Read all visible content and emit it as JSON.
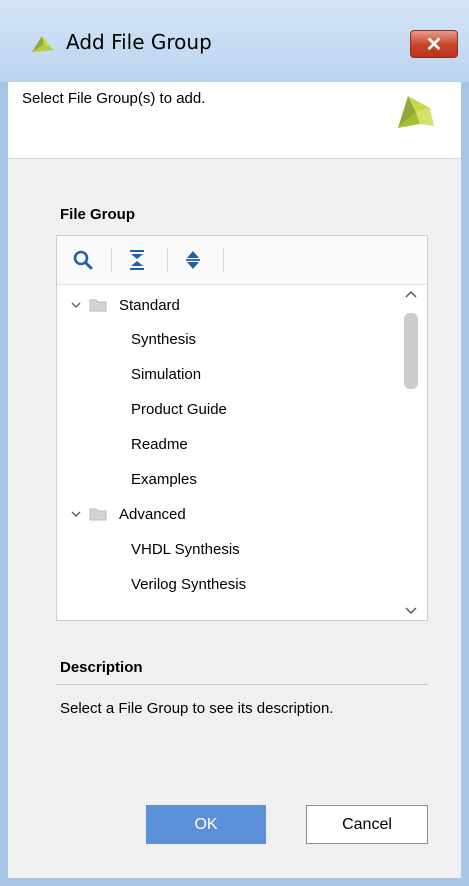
{
  "window": {
    "title": "Add File Group",
    "close_label": "✕"
  },
  "header": {
    "subtitle": "Select File Group(s) to add."
  },
  "file_group": {
    "label": "File Group",
    "toolbar": {
      "icons": [
        "search-icon",
        "collapse-all-icon",
        "expand-all-icon"
      ]
    },
    "tree": [
      {
        "label": "Standard",
        "type": "folder",
        "expanded": true
      },
      {
        "label": "Synthesis",
        "type": "item"
      },
      {
        "label": "Simulation",
        "type": "item"
      },
      {
        "label": "Product Guide",
        "type": "item"
      },
      {
        "label": "Readme",
        "type": "item"
      },
      {
        "label": "Examples",
        "type": "item"
      },
      {
        "label": "Advanced",
        "type": "folder",
        "expanded": true
      },
      {
        "label": "VHDL Synthesis",
        "type": "item"
      },
      {
        "label": "Verilog Synthesis",
        "type": "item"
      }
    ]
  },
  "description": {
    "label": "Description",
    "text": "Select a File Group to see its description."
  },
  "buttons": {
    "ok_label": "OK",
    "cancel_label": "Cancel"
  },
  "colors": {
    "accent": "#5b8fd8",
    "logo_green": "#9bb23a",
    "logo_yellow": "#c9d84a"
  }
}
